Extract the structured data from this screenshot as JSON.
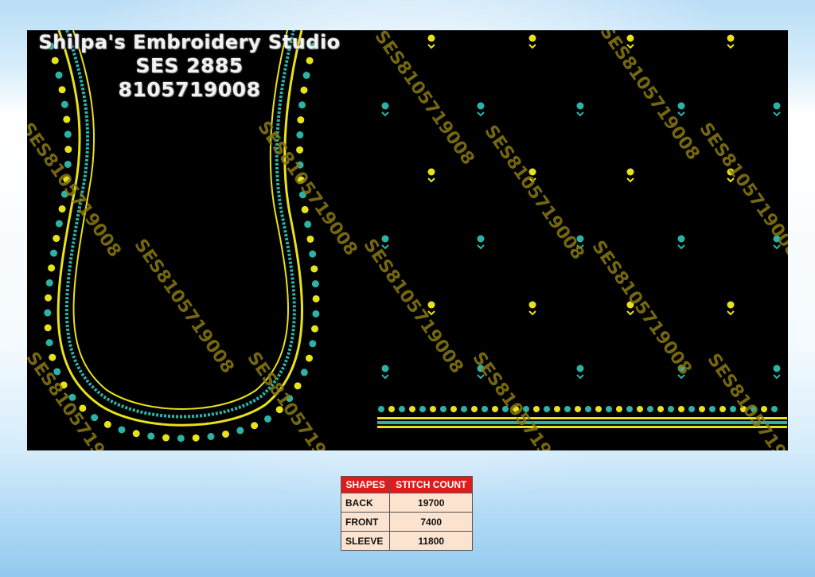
{
  "design": {
    "studio_name": "Shilpa's Embroidery Studio",
    "design_code": "SES 2885",
    "phone": "8105719008",
    "watermark_text": "SES8105719008",
    "colors": {
      "canvas": "#000000",
      "thread_yellow": "#e8e21a",
      "thread_teal": "#2bb3a8",
      "watermark": "#8a7a12"
    }
  },
  "stitch_table": {
    "headers": [
      "SHAPES",
      "STITCH COUNT"
    ],
    "rows": [
      {
        "shape": "BACK",
        "count": "19700"
      },
      {
        "shape": "FRONT",
        "count": "7400"
      },
      {
        "shape": "SLEEVE",
        "count": "11800"
      }
    ],
    "colors": {
      "header_bg": "#e01b1b",
      "cell_bg": "#fbe3cf"
    }
  }
}
